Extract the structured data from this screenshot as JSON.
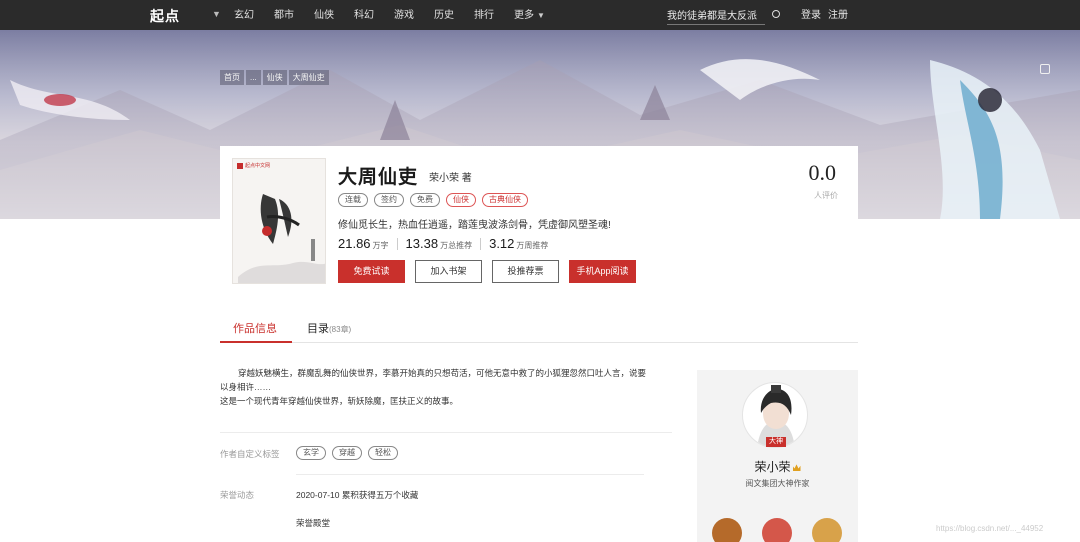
{
  "nav": {
    "logo": "起点",
    "links": [
      "玄幻",
      "都市",
      "仙侠",
      "科幻",
      "游戏",
      "历史",
      "排行",
      "更多"
    ],
    "search_value": "我的徒弟都是大反派",
    "login": "登录",
    "register": "注册"
  },
  "breadcrumb": [
    "首页",
    "...",
    "仙侠",
    "大周仙吏"
  ],
  "book": {
    "title": "大周仙吏",
    "author": "荣小荣 著",
    "tags": [
      "连载",
      "签约",
      "免费",
      "仙侠",
      "古典仙侠"
    ],
    "intro": "修仙觅长生，热血任逍遥，踏莲曳波涤剑骨，凭虚御风塑圣魂!",
    "stats": [
      {
        "value": "21.86",
        "unit": "万字"
      },
      {
        "value": "13.38",
        "unit": "万总推荐"
      },
      {
        "value": "3.12",
        "unit": "万周推荐"
      }
    ],
    "buttons": {
      "read": "免费试读",
      "shelf": "加入书架",
      "vote": "投推荐票",
      "app": "手机App阅读"
    },
    "score": "0.0",
    "score_label": "人评价",
    "cover_publisher": "起点中文网"
  },
  "tabs": {
    "info": "作品信息",
    "catalog": "目录",
    "catalog_count": "(83章)"
  },
  "description": [
    "穿越妖魅横生，群魔乱舞的仙侠世界，李慕开始真的只想苟活，可他无意中救了的小狐狸忽然口吐人言，说要",
    "以身相许……",
    "这是一个现代青年穿越仙侠世界，斩妖除魔，匡扶正义的故事。"
  ],
  "custom_tags": {
    "label": "作者自定义标签",
    "tags": [
      "玄学",
      "穿越",
      "轻松"
    ]
  },
  "honors": {
    "label": "荣誉动态",
    "items": [
      "2020-07-10  累积获得五万个收藏",
      "荣誉殿堂"
    ]
  },
  "author_panel": {
    "name": "荣小荣",
    "title": "阅文集团大神作家",
    "badge": "大神"
  },
  "watermark": "https://blog.csdn.net/..._44952"
}
